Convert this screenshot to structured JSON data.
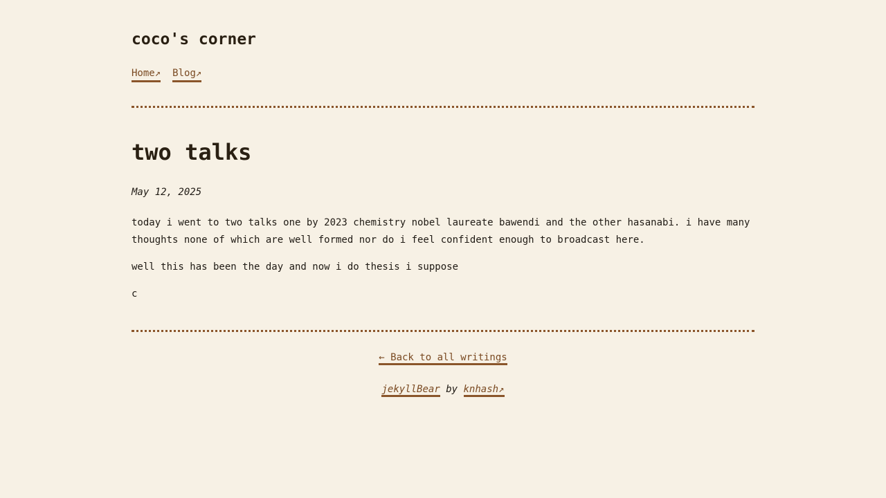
{
  "site": {
    "title": "coco's corner"
  },
  "nav": {
    "items": [
      {
        "label": "Home↗"
      },
      {
        "label": "Blog↗"
      }
    ]
  },
  "post": {
    "title": "two talks",
    "date": "May 12, 2025",
    "paragraphs": [
      "today i went to two talks one by 2023 chemistry nobel laureate bawendi and the other hasanabi. i have many thoughts none of which are well formed nor do i feel confident enough to broadcast here.",
      "well this has been the day and now i do thesis i suppose",
      "c"
    ]
  },
  "footer": {
    "back_label": "← Back to all writings",
    "theme_label": "jekyllBear",
    "by_text": "by",
    "author_label": "knhash↗"
  },
  "colors": {
    "background": "#f7f1e5",
    "link": "#7a4a22",
    "accent": "#8a552a",
    "text": "#1f1a14"
  }
}
